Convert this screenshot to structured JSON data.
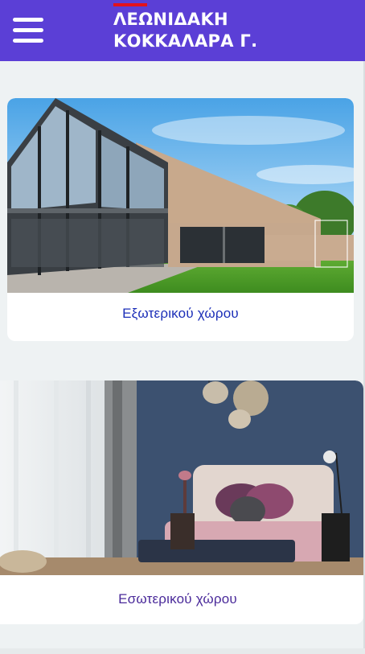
{
  "header": {
    "menu_icon": "hamburger-menu-icon",
    "brand_line1": "ΛΕΩΝΙΔΑΚΗ",
    "brand_line2": "ΚΟΚΚΑΛΑΡΑ Γ.",
    "colors": {
      "background": "#5b3fd6",
      "accent": "#e3121b",
      "text": "#ffffff"
    }
  },
  "cards": [
    {
      "caption": "Εξωτερικού χώρου",
      "image": "modern-house-exterior-photo"
    },
    {
      "caption": "Εσωτερικού χώρου",
      "image": "bedroom-interior-photo"
    }
  ],
  "colors": {
    "page_background": "#eef2f3",
    "caption_exterior": "#1c2fb8",
    "caption_interior": "#4a2a9a"
  }
}
